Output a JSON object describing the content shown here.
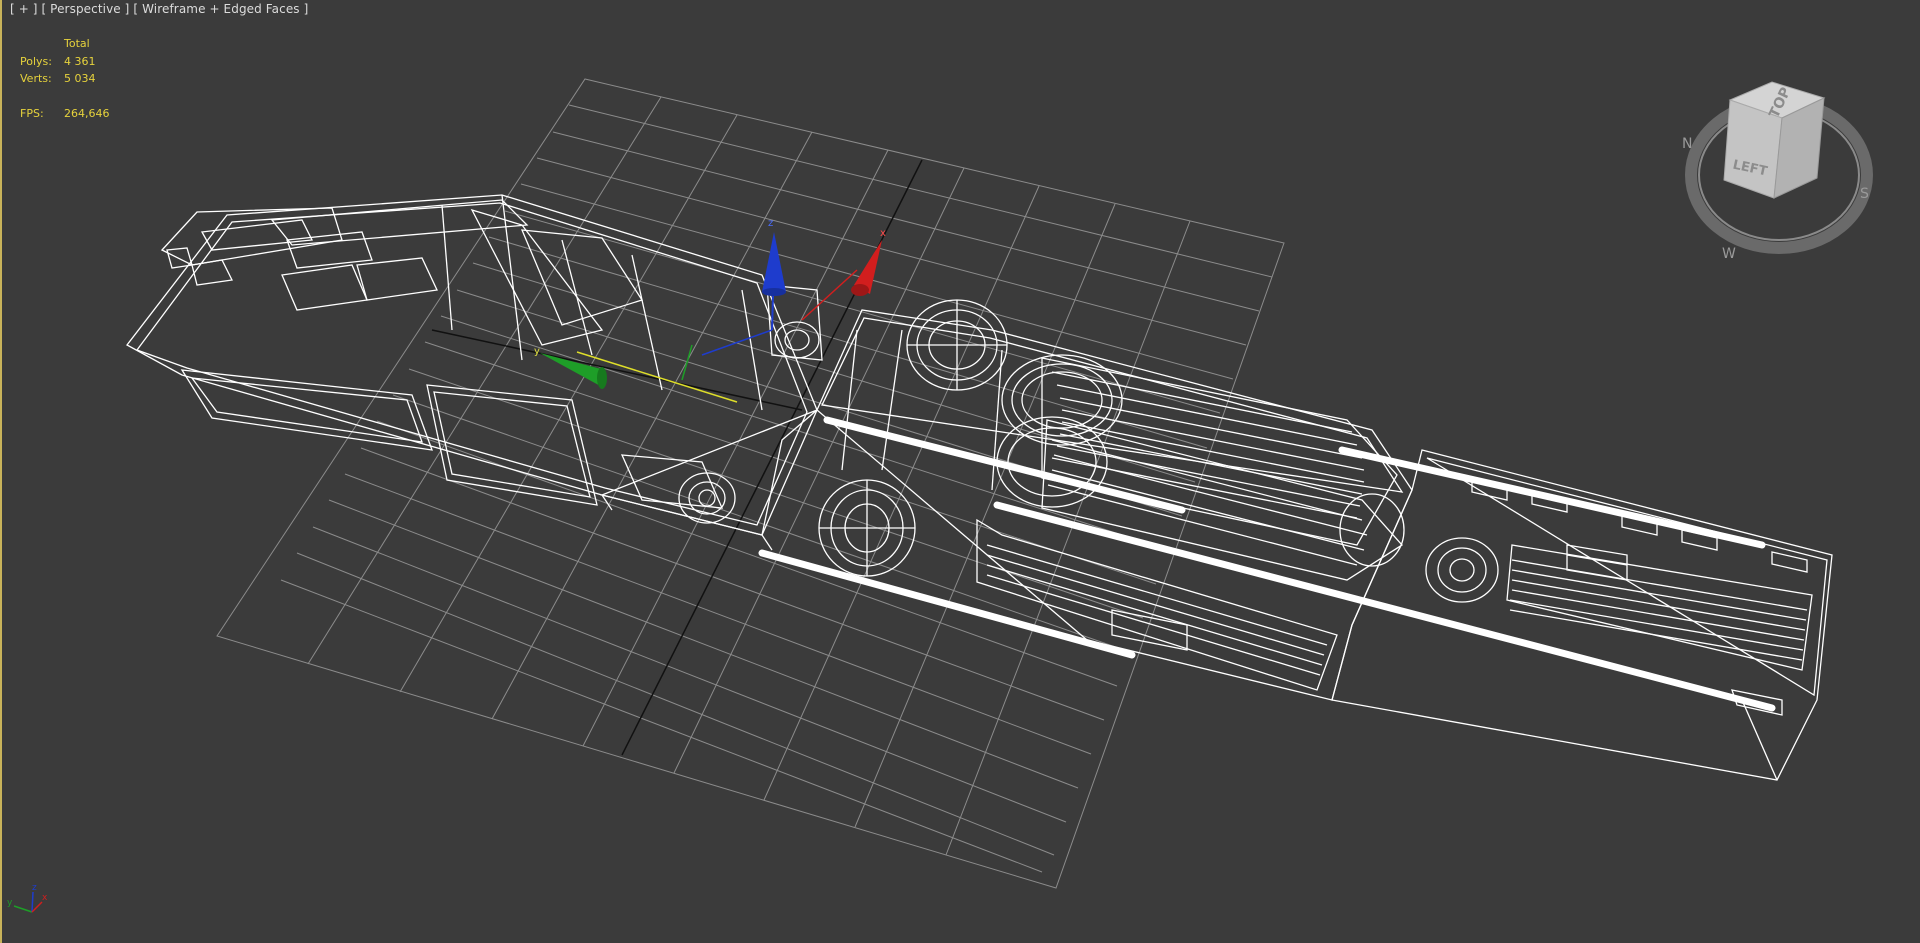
{
  "viewport": {
    "label_plus": "[ + ]",
    "label_view": "[ Perspective ]",
    "label_shading": "[ Wireframe + Edged Faces ]"
  },
  "stats": {
    "header": "Total",
    "polys_label": "Polys:",
    "polys_value": "4 361",
    "verts_label": "Verts:",
    "verts_value": "5 034",
    "fps_label": "FPS:",
    "fps_value": "264,646"
  },
  "viewcube": {
    "face_top": "TOP",
    "face_left": "LEFT"
  },
  "gizmo": {
    "axis_x": "x",
    "axis_y": "y",
    "axis_z": "z"
  },
  "colors": {
    "background": "#3b3b3b",
    "grid": "#9a9a9a",
    "wire": "#ffffff",
    "stats_text": "#e6d23c",
    "axis_x": "#d21e1e",
    "axis_y": "#1e9e28",
    "axis_z": "#1e3ccd"
  }
}
